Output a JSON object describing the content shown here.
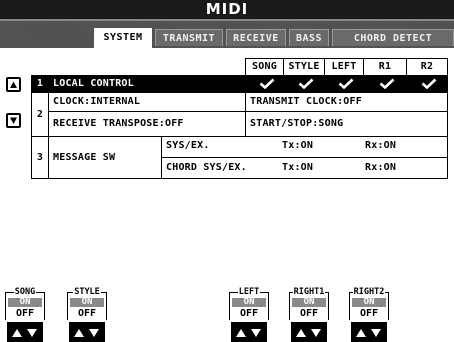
{
  "title": "MIDI",
  "tabs": [
    {
      "label": "SYSTEM",
      "active": true
    },
    {
      "label": "TRANSMIT",
      "active": false
    },
    {
      "label": "RECEIVE",
      "active": false
    },
    {
      "label": "BASS",
      "active": false
    },
    {
      "label": "CHORD DETECT",
      "active": false
    }
  ],
  "columns": [
    "SONG",
    "STYLE",
    "LEFT",
    "R1",
    "R2"
  ],
  "rows": {
    "r1": {
      "num": "1",
      "label": "LOCAL CONTROL"
    },
    "r2": {
      "num": "2",
      "clock": "CLOCK:INTERNAL",
      "transmit_clock": "TRANSMIT CLOCK:OFF",
      "receive_transpose": "RECEIVE TRANSPOSE:OFF",
      "start_stop": "START/STOP:SONG"
    },
    "r3": {
      "num": "3",
      "label": "MESSAGE SW",
      "sys_ex": {
        "label": "SYS/EX.",
        "tx": "Tx:ON",
        "rx": "Rx:ON"
      },
      "chord_sys_ex": {
        "label": "CHORD SYS/EX.",
        "tx": "Tx:ON",
        "rx": "Rx:ON"
      }
    }
  },
  "parts": [
    {
      "label": "SONG",
      "on": "ON",
      "off": "OFF"
    },
    {
      "label": "STYLE",
      "on": "ON",
      "off": "OFF"
    },
    {
      "label": "LEFT",
      "on": "ON",
      "off": "OFF"
    },
    {
      "label": "RIGHT1",
      "on": "ON",
      "off": "OFF"
    },
    {
      "label": "RIGHT2",
      "on": "ON",
      "off": "OFF"
    }
  ],
  "icons": {
    "scroll_up": "triangle-up-icon",
    "scroll_down": "triangle-down-icon",
    "check": "check-icon",
    "updown": "up-down-arrows-icon"
  }
}
